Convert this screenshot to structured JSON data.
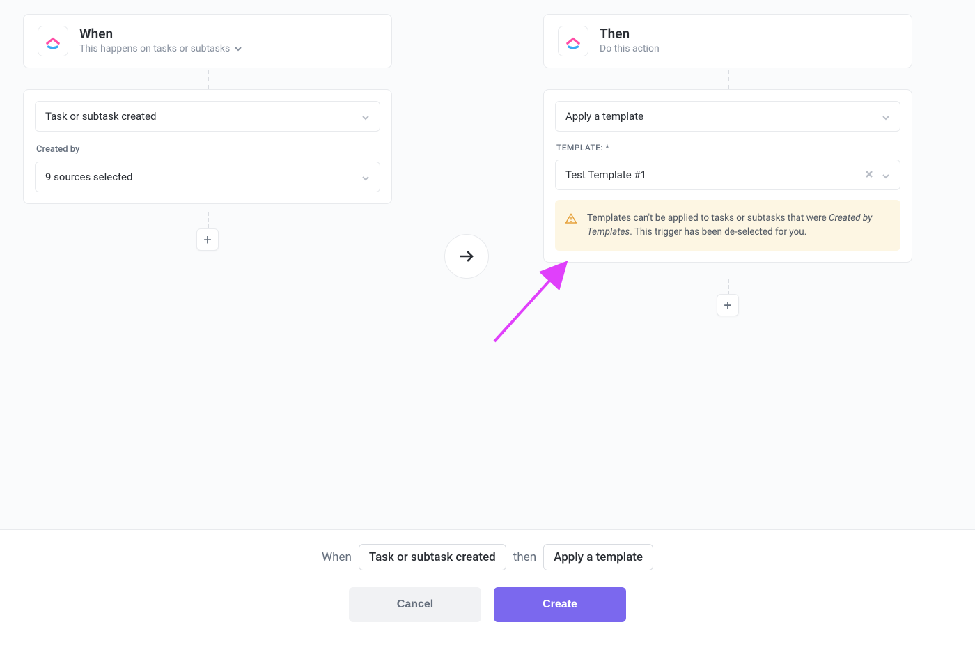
{
  "when": {
    "title": "When",
    "subtitle": "This happens on tasks or subtasks",
    "trigger_dropdown": "Task or subtask created",
    "filter_label": "Created by",
    "filter_value": "9 sources selected"
  },
  "then": {
    "title": "Then",
    "subtitle": "Do this action",
    "action_dropdown": "Apply a template",
    "template_label": "TEMPLATE: *",
    "template_value": "Test Template #1",
    "warning_prefix": "Templates can't be applied to tasks or subtasks that were ",
    "warning_em": "Created by Templates",
    "warning_suffix": ". This trigger has been de-selected for you."
  },
  "footer": {
    "when_word": "When",
    "when_pill": "Task or subtask created",
    "then_word": "then",
    "then_pill": "Apply a template",
    "cancel": "Cancel",
    "create": "Create"
  }
}
